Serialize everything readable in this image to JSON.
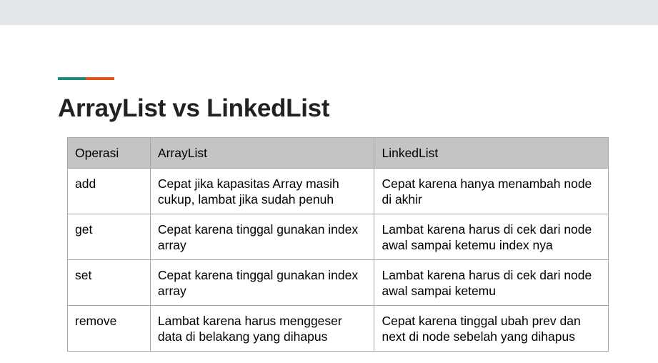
{
  "slide": {
    "title": "ArrayList vs LinkedList"
  },
  "table": {
    "headers": [
      "Operasi",
      "ArrayList",
      "LinkedList"
    ],
    "rows": [
      [
        "add",
        "Cepat jika kapasitas Array masih cukup, lambat jika sudah penuh",
        "Cepat karena hanya menambah node di akhir"
      ],
      [
        "get",
        "Cepat karena tinggal gunakan index array",
        "Lambat karena harus di cek dari node awal sampai ketemu index nya"
      ],
      [
        "set",
        "Cepat karena tinggal gunakan index array",
        "Lambat karena harus di cek dari node awal sampai ketemu"
      ],
      [
        "remove",
        "Lambat karena harus menggeser data di belakang yang dihapus",
        "Cepat karena tinggal ubah prev dan next di node sebelah yang dihapus"
      ]
    ]
  },
  "colors": {
    "accent_teal": "#1f8c78",
    "accent_orange": "#e3531c",
    "header_bg": "#c4c4c4",
    "top_bar": "#e3e6e9"
  }
}
